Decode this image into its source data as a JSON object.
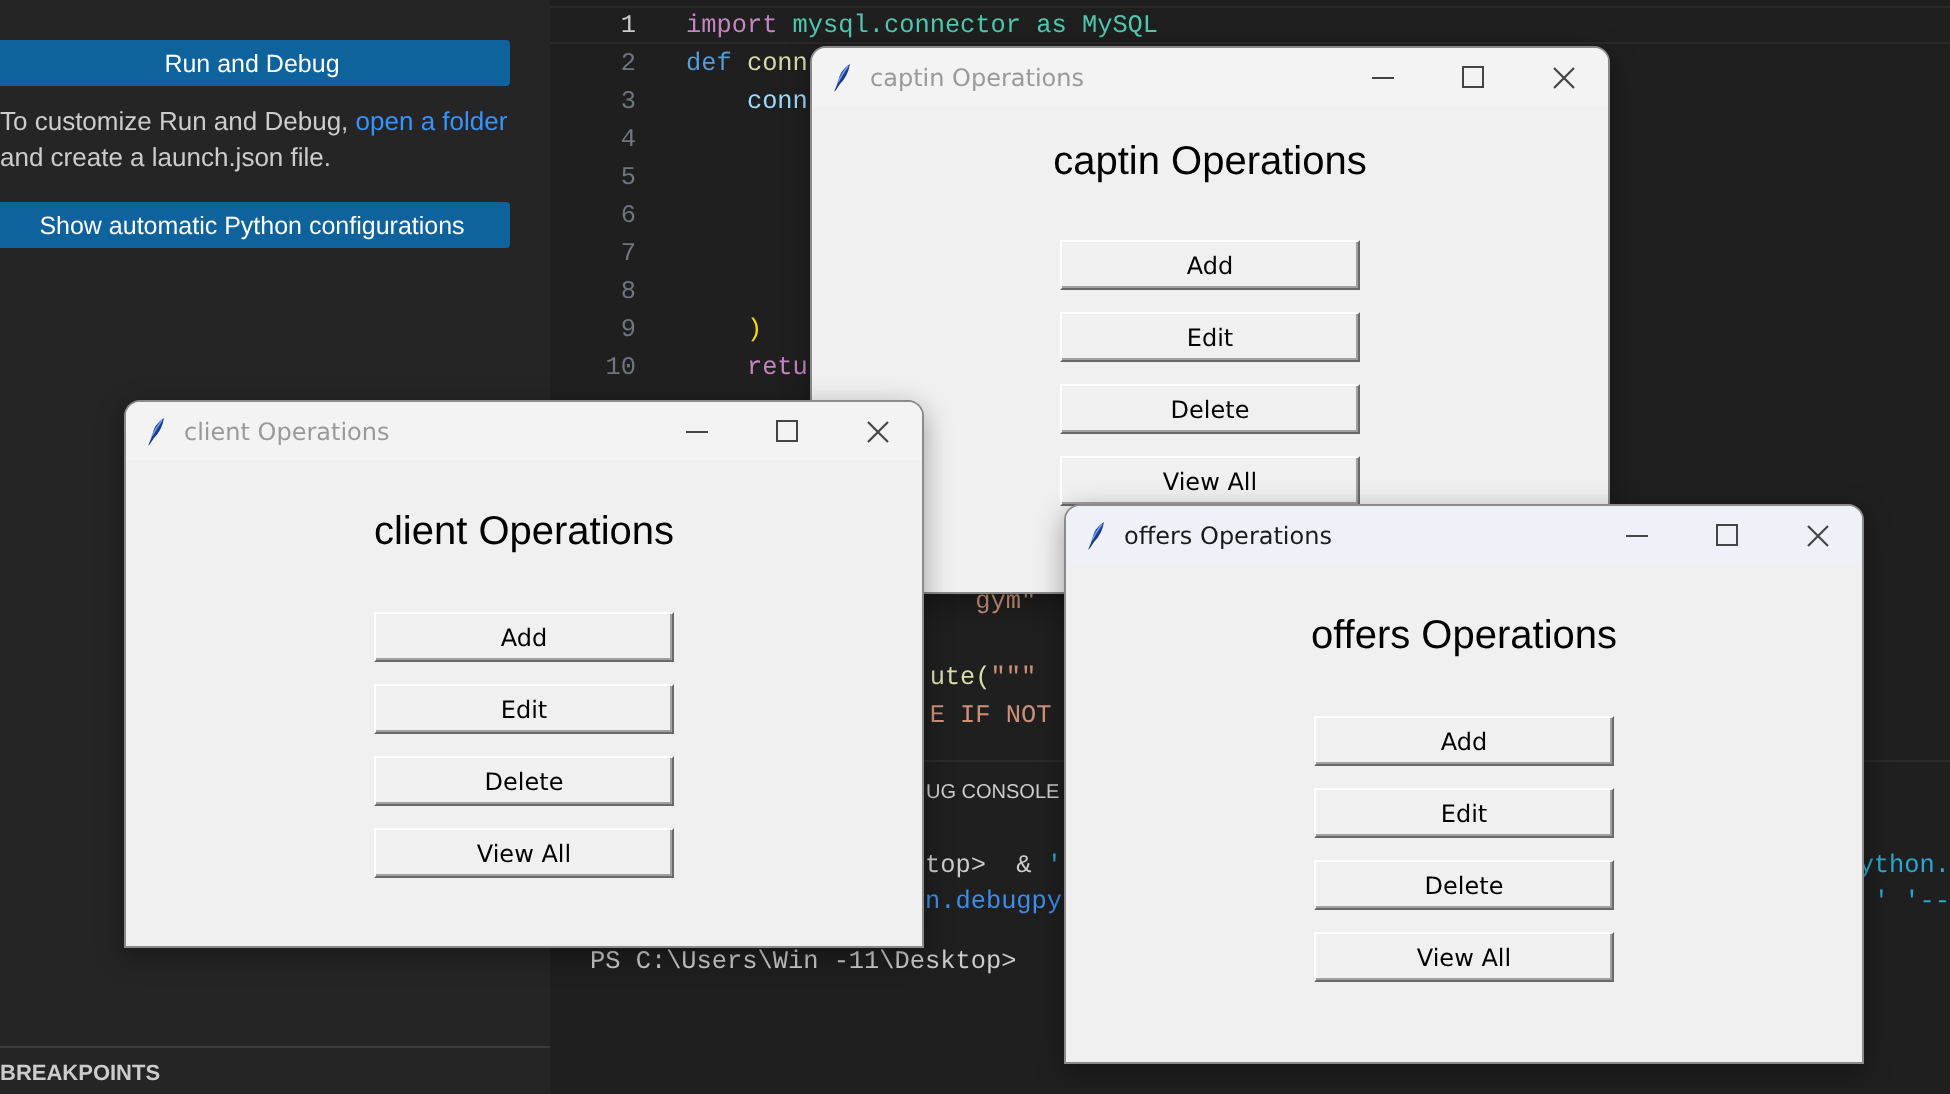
{
  "sidebar": {
    "run_button": "Run and Debug",
    "hint": {
      "before": "To customize Run and Debug, ",
      "link": "open a folder",
      "after": " and create a launch.json file."
    },
    "config_button": "Show automatic Python configurations",
    "section": "BREAKPOINTS"
  },
  "editor": {
    "lines": [
      {
        "number": "1",
        "current": true,
        "tokens": [
          {
            "text": "import",
            "kind": "keyword"
          },
          {
            "text": " mysql.connector as MySQL",
            "kind": "module"
          }
        ]
      },
      {
        "number": "2",
        "current": false,
        "tokens": [
          {
            "text": "def",
            "kind": "storage"
          },
          {
            "text": " conn",
            "kind": "func"
          }
        ]
      },
      {
        "number": "3",
        "current": false,
        "tokens": [
          {
            "text": "    conn",
            "kind": "var"
          }
        ]
      },
      {
        "number": "4",
        "current": false
      },
      {
        "number": "5",
        "current": false
      },
      {
        "number": "6",
        "current": false
      },
      {
        "number": "7",
        "current": false
      },
      {
        "number": "8",
        "current": false
      },
      {
        "number": "9",
        "current": false,
        "tokens": [
          {
            "text": "    )",
            "kind": "bracket"
          }
        ]
      },
      {
        "number": "10",
        "current": false,
        "tokens": [
          {
            "text": "    retu",
            "kind": "keyword"
          }
        ]
      }
    ],
    "fragments": [
      {
        "tokens": [
          {
            "text": "                   gym\"",
            "kind": "string"
          }
        ]
      },
      {
        "tokens": [
          {
            "text": "                ute(",
            "kind": "func"
          },
          {
            "text": "\"\"\"",
            "kind": "string"
          }
        ]
      },
      {
        "tokens": [
          {
            "text": "                E IF NOT",
            "kind": "string"
          }
        ]
      }
    ]
  },
  "panel": {
    "tab": "UG CONSOLE",
    "terminal": [
      {
        "left": [
          {
            "text": "                      top>  & ",
            "kind": "plain"
          },
          {
            "text": "'",
            "kind": "cyan"
          }
        ],
        "right": [
          {
            "text": "ython.",
            "kind": "cyan"
          }
        ]
      },
      {
        "left": [
          {
            "text": "                      n.debugpy",
            "kind": "blue"
          }
        ],
        "right": [
          {
            "text": "' '--",
            "kind": "cyan"
          }
        ]
      },
      {
        "left": [
          {
            "text": "PS C:\\Users\\Win -11\\Desktop>",
            "kind": "plain"
          }
        ]
      }
    ]
  },
  "windows": [
    {
      "title": "captin Operations",
      "active": false,
      "heading": "captin Operations",
      "buttons": [
        "Add",
        "Edit",
        "Delete",
        "View All"
      ]
    },
    {
      "title": "client Operations",
      "active": false,
      "heading": "client Operations",
      "buttons": [
        "Add",
        "Edit",
        "Delete",
        "View All"
      ]
    },
    {
      "title": "offers Operations",
      "active": true,
      "heading": "offers Operations",
      "buttons": [
        "Add",
        "Edit",
        "Delete",
        "View All"
      ]
    }
  ]
}
